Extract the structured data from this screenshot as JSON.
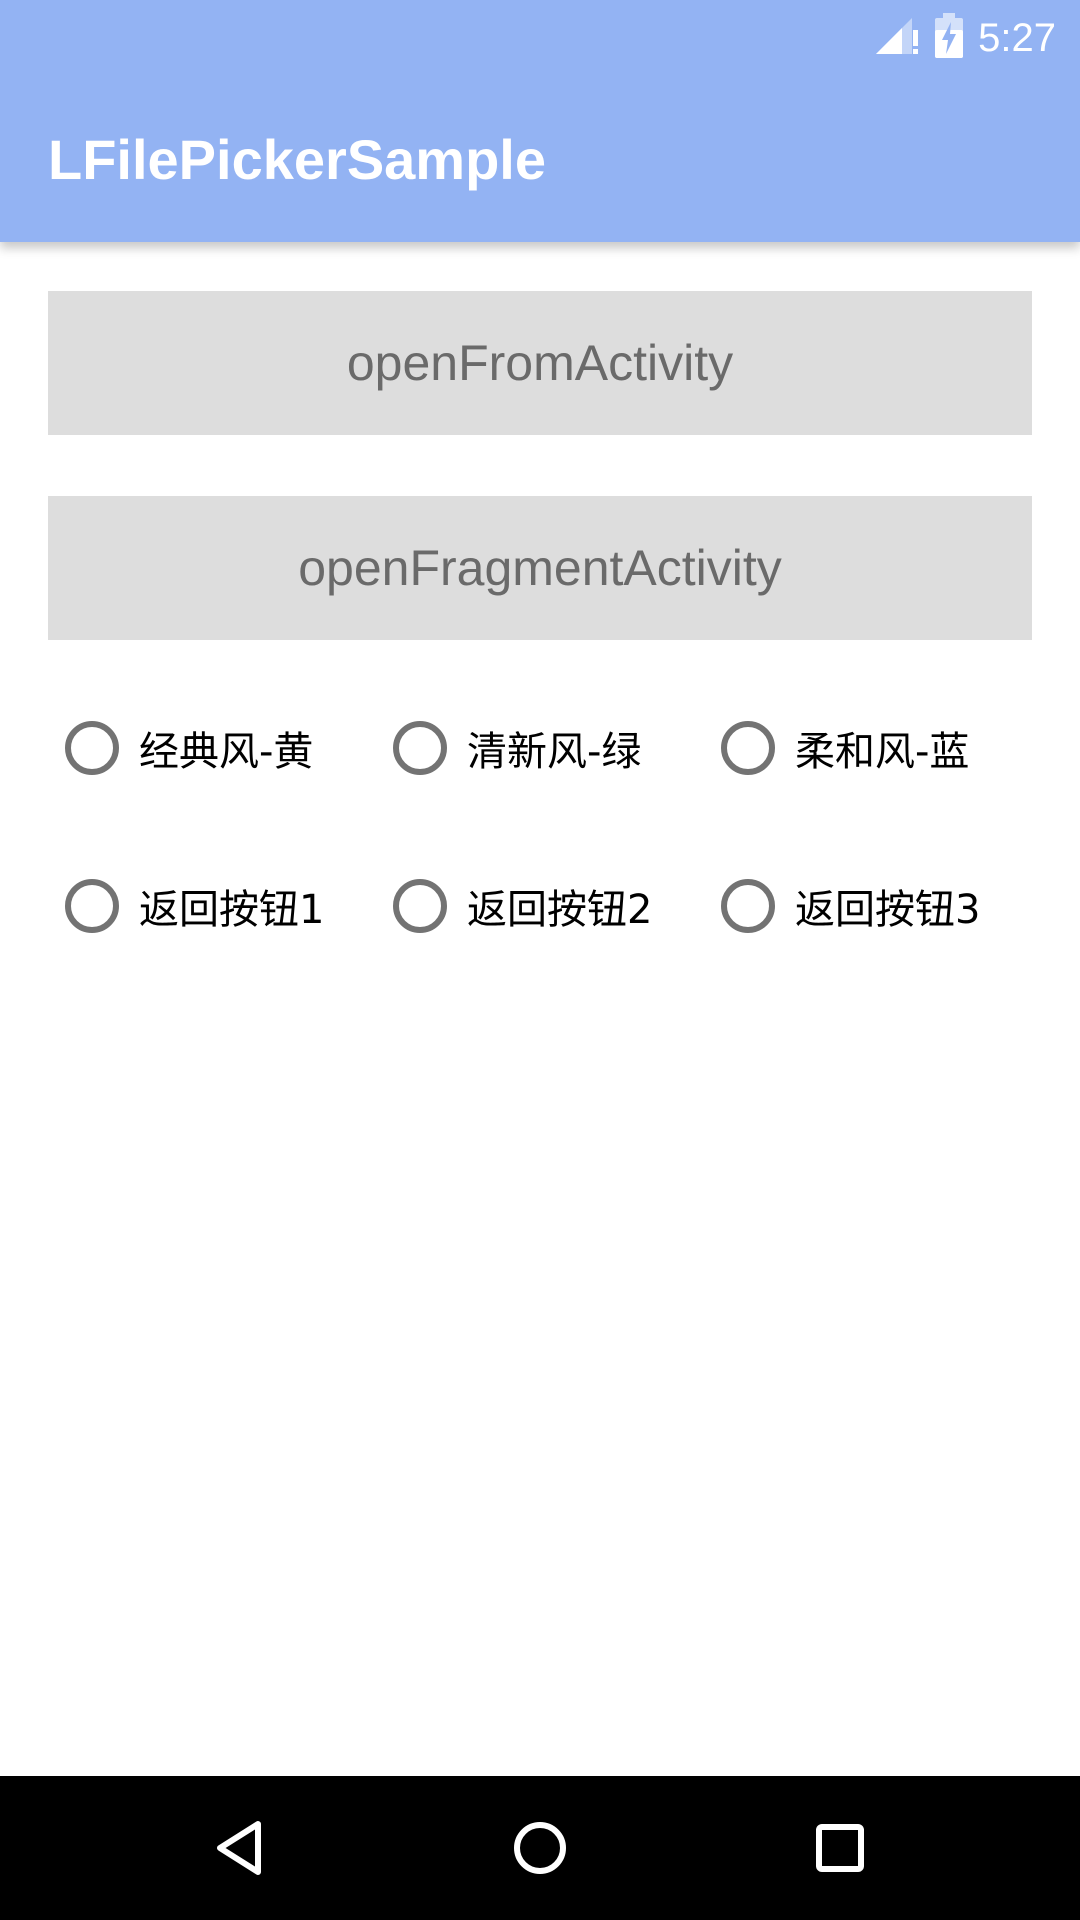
{
  "status_bar": {
    "time": "5:27",
    "icons": [
      "signal-icon",
      "battery-charging-icon"
    ]
  },
  "app_bar": {
    "title": "LFilePickerSample",
    "color": "#93b3f3"
  },
  "buttons": {
    "open_from_activity": "openFromActivity",
    "open_fragment_activity": "openFragmentActivity"
  },
  "theme_options": {
    "items": [
      {
        "label": "经典风-黄",
        "checked": false
      },
      {
        "label": "清新风-绿",
        "checked": false
      },
      {
        "label": "柔和风-蓝",
        "checked": false
      }
    ]
  },
  "back_button_options": {
    "items": [
      {
        "label": "返回按钮1",
        "checked": false
      },
      {
        "label": "返回按钮2",
        "checked": false
      },
      {
        "label": "返回按钮3",
        "checked": false
      }
    ]
  },
  "nav_bar": {
    "icons": [
      "back-icon",
      "home-icon",
      "recents-icon"
    ]
  }
}
